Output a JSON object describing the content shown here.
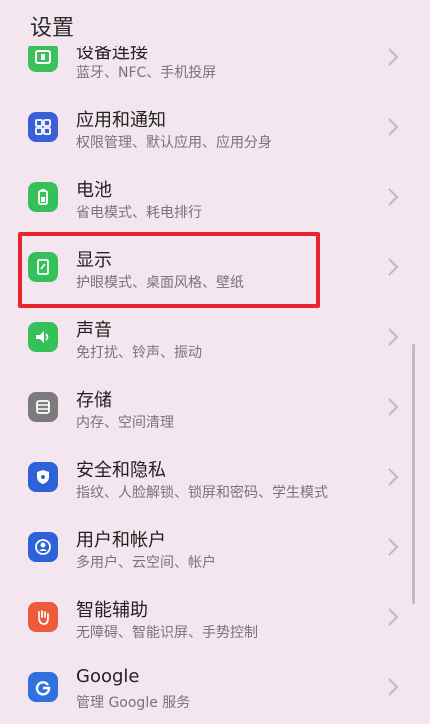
{
  "header": {
    "title": "设置"
  },
  "items": [
    {
      "label": "设备连接",
      "sub": "蓝牙、NFC、手机投屏",
      "color": "#3cc05d",
      "icon": "device-connection-icon"
    },
    {
      "label": "应用和通知",
      "sub": "权限管理、默认应用、应用分身",
      "color": "#3b5fd6",
      "icon": "apps-grid-icon"
    },
    {
      "label": "电池",
      "sub": "省电模式、耗电排行",
      "color": "#36c05a",
      "icon": "battery-icon"
    },
    {
      "label": "显示",
      "sub": "护眼模式、桌面风格、壁纸",
      "color": "#34c05a",
      "icon": "display-icon"
    },
    {
      "label": "声音",
      "sub": "免打扰、铃声、振动",
      "color": "#36c05a",
      "icon": "speaker-icon"
    },
    {
      "label": "存储",
      "sub": "内存、空间清理",
      "color": "#7c7a7d",
      "icon": "storage-icon"
    },
    {
      "label": "安全和隐私",
      "sub": "指纹、人脸解锁、锁屏和密码、学生模式",
      "color": "#2d62d9",
      "icon": "shield-icon"
    },
    {
      "label": "用户和帐户",
      "sub": "多用户、云空间、帐户",
      "color": "#2d62d9",
      "icon": "user-icon"
    },
    {
      "label": "智能辅助",
      "sub": "无障碍、智能识屏、手势控制",
      "color": "#ef5a3a",
      "icon": "hand-icon"
    },
    {
      "label": "Google",
      "sub": "管理 Google 服务",
      "color": "#2f72df",
      "icon": "google-icon"
    }
  ]
}
